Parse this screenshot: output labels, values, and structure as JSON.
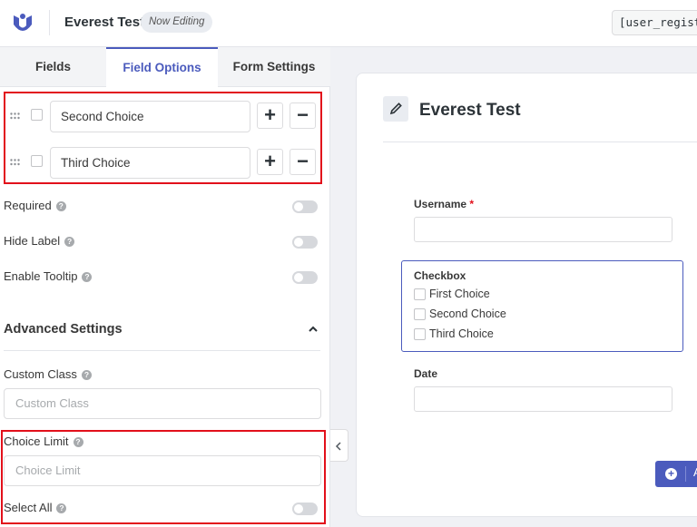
{
  "header": {
    "logo_icon": "user-registration-logo-icon",
    "form_title": "Everest Test",
    "badge": "Now Editing",
    "shortcode": "[user_registr"
  },
  "tabs": [
    {
      "label": "Fields",
      "active": false
    },
    {
      "label": "Field Options",
      "active": true
    },
    {
      "label": "Form Settings",
      "active": false
    }
  ],
  "choices": [
    {
      "value": "Second Choice"
    },
    {
      "value": "Third Choice"
    }
  ],
  "settings": {
    "required": {
      "label": "Required",
      "enabled": false
    },
    "hide_label": {
      "label": "Hide Label",
      "enabled": false
    },
    "enable_tooltip": {
      "label": "Enable Tooltip",
      "enabled": false
    }
  },
  "advanced": {
    "title": "Advanced Settings",
    "custom_class": {
      "label": "Custom Class",
      "placeholder": "Custom Class"
    },
    "choice_limit": {
      "label": "Choice Limit",
      "placeholder": "Choice Limit"
    },
    "select_all": {
      "label": "Select All",
      "enabled": false
    }
  },
  "preview": {
    "title": "Everest Test",
    "username_label": "Username",
    "required_mark": "*",
    "checkbox_label": "Checkbox",
    "checkbox_options": [
      "First Choice",
      "Second Choice",
      "Third Choice"
    ],
    "date_label": "Date",
    "add_button_label": "A"
  },
  "colors": {
    "accent": "#4b5bbd",
    "highlight_border": "#e2101b"
  }
}
